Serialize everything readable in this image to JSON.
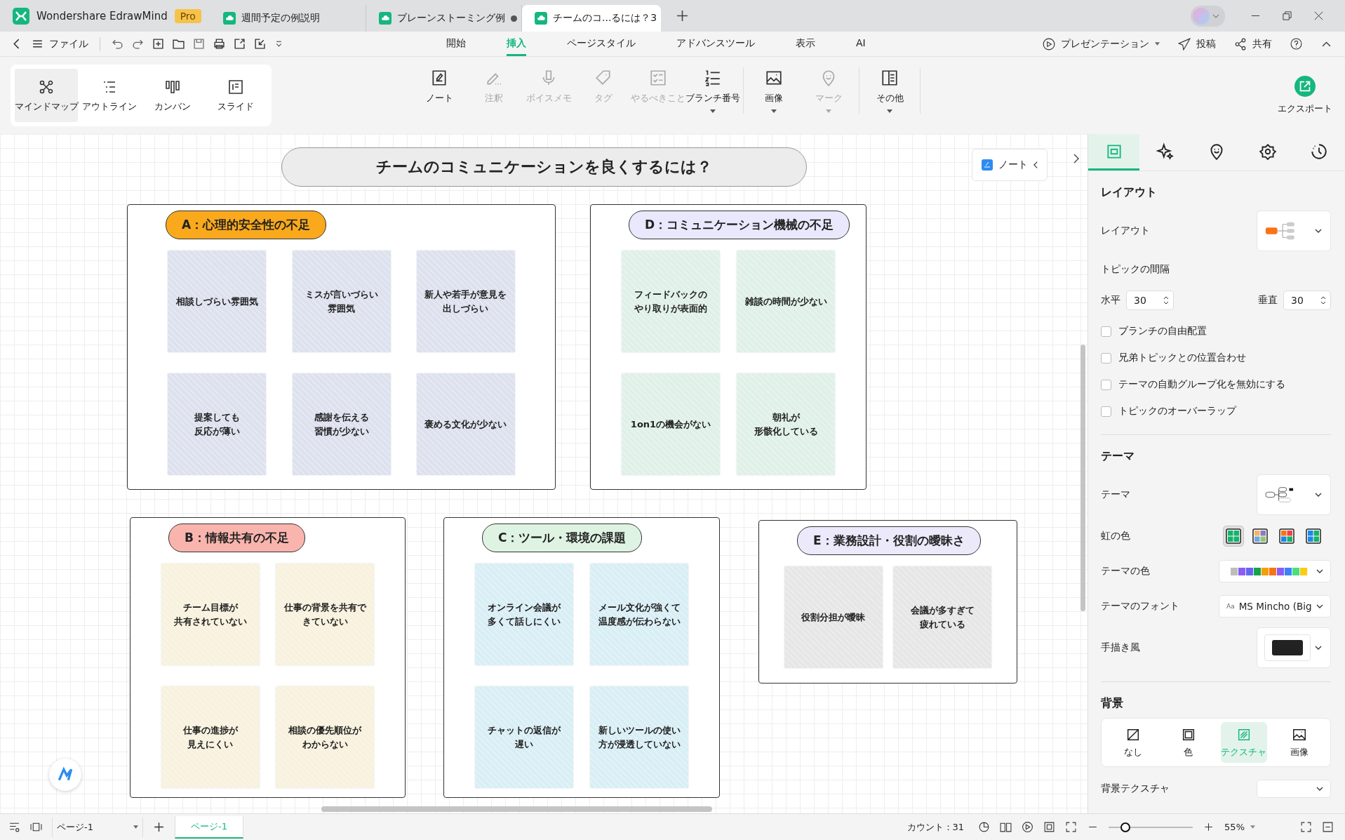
{
  "app": {
    "name": "Wondershare EdrawMind",
    "badge": "Pro"
  },
  "tabs": [
    {
      "label": "週間予定の例説明",
      "selected": false,
      "modified": false
    },
    {
      "label": "ブレーンストーミング例",
      "selected": false,
      "modified": true
    },
    {
      "label": "チームのコ...るには？3",
      "selected": true,
      "modified": false
    }
  ],
  "menu": {
    "file": "ファイル",
    "ribbon_tabs": [
      {
        "label": "開始",
        "selected": false
      },
      {
        "label": "挿入",
        "selected": true
      },
      {
        "label": "ページスタイル",
        "selected": false
      },
      {
        "label": "アドバンスツール",
        "selected": false
      },
      {
        "label": "表示",
        "selected": false
      },
      {
        "label": "AI",
        "selected": false
      }
    ],
    "actions": [
      {
        "label": "プレゼンテーション",
        "has_menu": true
      },
      {
        "label": "投稿",
        "has_menu": false
      },
      {
        "label": "共有",
        "has_menu": false
      }
    ]
  },
  "views": [
    {
      "label": "マインドマップ",
      "selected": true
    },
    {
      "label": "アウトライン",
      "selected": false
    },
    {
      "label": "カンバン",
      "selected": false
    },
    {
      "label": "スライド",
      "selected": false
    }
  ],
  "ribbon": [
    {
      "label": "ノート",
      "disabled": false,
      "has_menu": false
    },
    {
      "label": "注釈",
      "disabled": true,
      "has_menu": false
    },
    {
      "label": "ボイスメモ",
      "disabled": true,
      "has_menu": false
    },
    {
      "label": "タグ",
      "disabled": true,
      "has_menu": false
    },
    {
      "label": "やるべきこと",
      "disabled": true,
      "has_menu": false
    },
    {
      "label": "ブランチ番号",
      "disabled": false,
      "has_menu": true
    },
    {
      "label": "画像",
      "disabled": false,
      "has_menu": true
    },
    {
      "label": "マーク",
      "disabled": true,
      "has_menu": true
    },
    {
      "label": "その他",
      "disabled": false,
      "has_menu": true
    }
  ],
  "export": "エクスポート",
  "canvas": {
    "title": "チームのコミュニケーションを良くするには？",
    "note_button": "ノート",
    "groups": [
      {
        "label": "A：心理的安全性の不足",
        "color": "#f9a91b",
        "notes": [
          {
            "lines": [
              "相談しづらい雰囲気"
            ],
            "color": "#dde1ee"
          },
          {
            "lines": [
              "ミスが言いづらい",
              "雰囲気"
            ],
            "color": "#dde1ee"
          },
          {
            "lines": [
              "新人や若手が意見を",
              "出しづらい"
            ],
            "color": "#dde1ee"
          },
          {
            "lines": [
              "提案しても",
              "反応が薄い"
            ],
            "color": "#dde1ee"
          },
          {
            "lines": [
              "感謝を伝える",
              "習慣が少ない"
            ],
            "color": "#dde1ee"
          },
          {
            "lines": [
              "褒める文化が少ない"
            ],
            "color": "#dde1ee"
          }
        ]
      },
      {
        "label": "D：コミュニケーション機械の不足",
        "color": "#e9e8fd",
        "notes": [
          {
            "lines": [
              "フィードバックの",
              "やり取りが表面的"
            ],
            "color": "#dff0e8"
          },
          {
            "lines": [
              "雑談の時間が少ない"
            ],
            "color": "#dff0e8"
          },
          {
            "lines": [
              "1on1の機会がない"
            ],
            "color": "#dff0e8"
          },
          {
            "lines": [
              "朝礼が",
              "形骸化している"
            ],
            "color": "#dff0e8"
          }
        ]
      },
      {
        "label": "B：情報共有の不足",
        "color": "#f9b5ad",
        "notes": [
          {
            "lines": [
              "チーム目標が",
              "共有されていない"
            ],
            "color": "#f7f1dd"
          },
          {
            "lines": [
              "仕事の背景を共有で",
              "きていない"
            ],
            "color": "#f7f1dd"
          },
          {
            "lines": [
              "仕事の進捗が",
              "見えにくい"
            ],
            "color": "#f7f1dd"
          },
          {
            "lines": [
              "相談の優先順位が",
              "わからない"
            ],
            "color": "#f7f1dd"
          }
        ]
      },
      {
        "label": "C：ツール・環境の課題",
        "color": "#dff3e3",
        "notes": [
          {
            "lines": [
              "オンライン会議が",
              "多くて話しにくい"
            ],
            "color": "#d8eef5"
          },
          {
            "lines": [
              "メール文化が強くて",
              "温度感が伝わらない"
            ],
            "color": "#d8eef5"
          },
          {
            "lines": [
              "チャットの返信が",
              "遅い"
            ],
            "color": "#d8eef5"
          },
          {
            "lines": [
              "新しいツールの使い",
              "方が浸透していない"
            ],
            "color": "#d8eef5"
          }
        ]
      },
      {
        "label": "E：業務設計・役割の曖昧さ",
        "color": "#ece9fb",
        "notes": [
          {
            "lines": [
              "役割分担が曖昧"
            ],
            "color": "#e6e6e6"
          },
          {
            "lines": [
              "会議が多すぎて",
              "疲れている"
            ],
            "color": "#e6e6e6"
          }
        ]
      }
    ]
  },
  "panel": {
    "tabs": [
      {
        "selected": true
      },
      {
        "selected": false
      },
      {
        "selected": false
      },
      {
        "selected": false
      },
      {
        "selected": false
      }
    ],
    "layout_heading": "レイアウト",
    "layout_label": "レイアウト",
    "spacing_label": "トピックの間隔",
    "horizontal_label": "水平",
    "horizontal_value": "30",
    "vertical_label": "垂直",
    "vertical_value": "30",
    "options": [
      {
        "label": "ブランチの自由配置",
        "checked": false
      },
      {
        "label": "兄弟トピックとの位置合わせ",
        "checked": false
      },
      {
        "label": "テーマの自動グループ化を無効にする",
        "checked": false
      },
      {
        "label": "トピックのオーバーラップ",
        "checked": false
      }
    ],
    "theme_heading": "テーマ",
    "theme_label": "テーマ",
    "rainbow_label": "虹の色",
    "rainbow_options": [
      {
        "selected": true
      },
      {
        "selected": false
      },
      {
        "selected": false
      },
      {
        "selected": false
      }
    ],
    "theme_color_label": "テーマの色",
    "theme_font_label": "テーマのフォント",
    "theme_font_sample": "Aa",
    "theme_font_value": "MS Mincho (Big",
    "hand_drawn_label": "手描き風",
    "background_heading": "背景",
    "background_options": [
      {
        "label": "なし",
        "selected": false
      },
      {
        "label": "色",
        "selected": false
      },
      {
        "label": "テクスチャ",
        "selected": true
      },
      {
        "label": "画像",
        "selected": false
      }
    ],
    "texture_label": "背景テクスチャ"
  },
  "status_bar": {
    "page_select": "ページ-1",
    "pages": [
      {
        "label": "ページ-1",
        "selected": true
      }
    ],
    "count": "カウント：31",
    "zoom": {
      "level": 0.2,
      "reading": "55%"
    }
  }
}
